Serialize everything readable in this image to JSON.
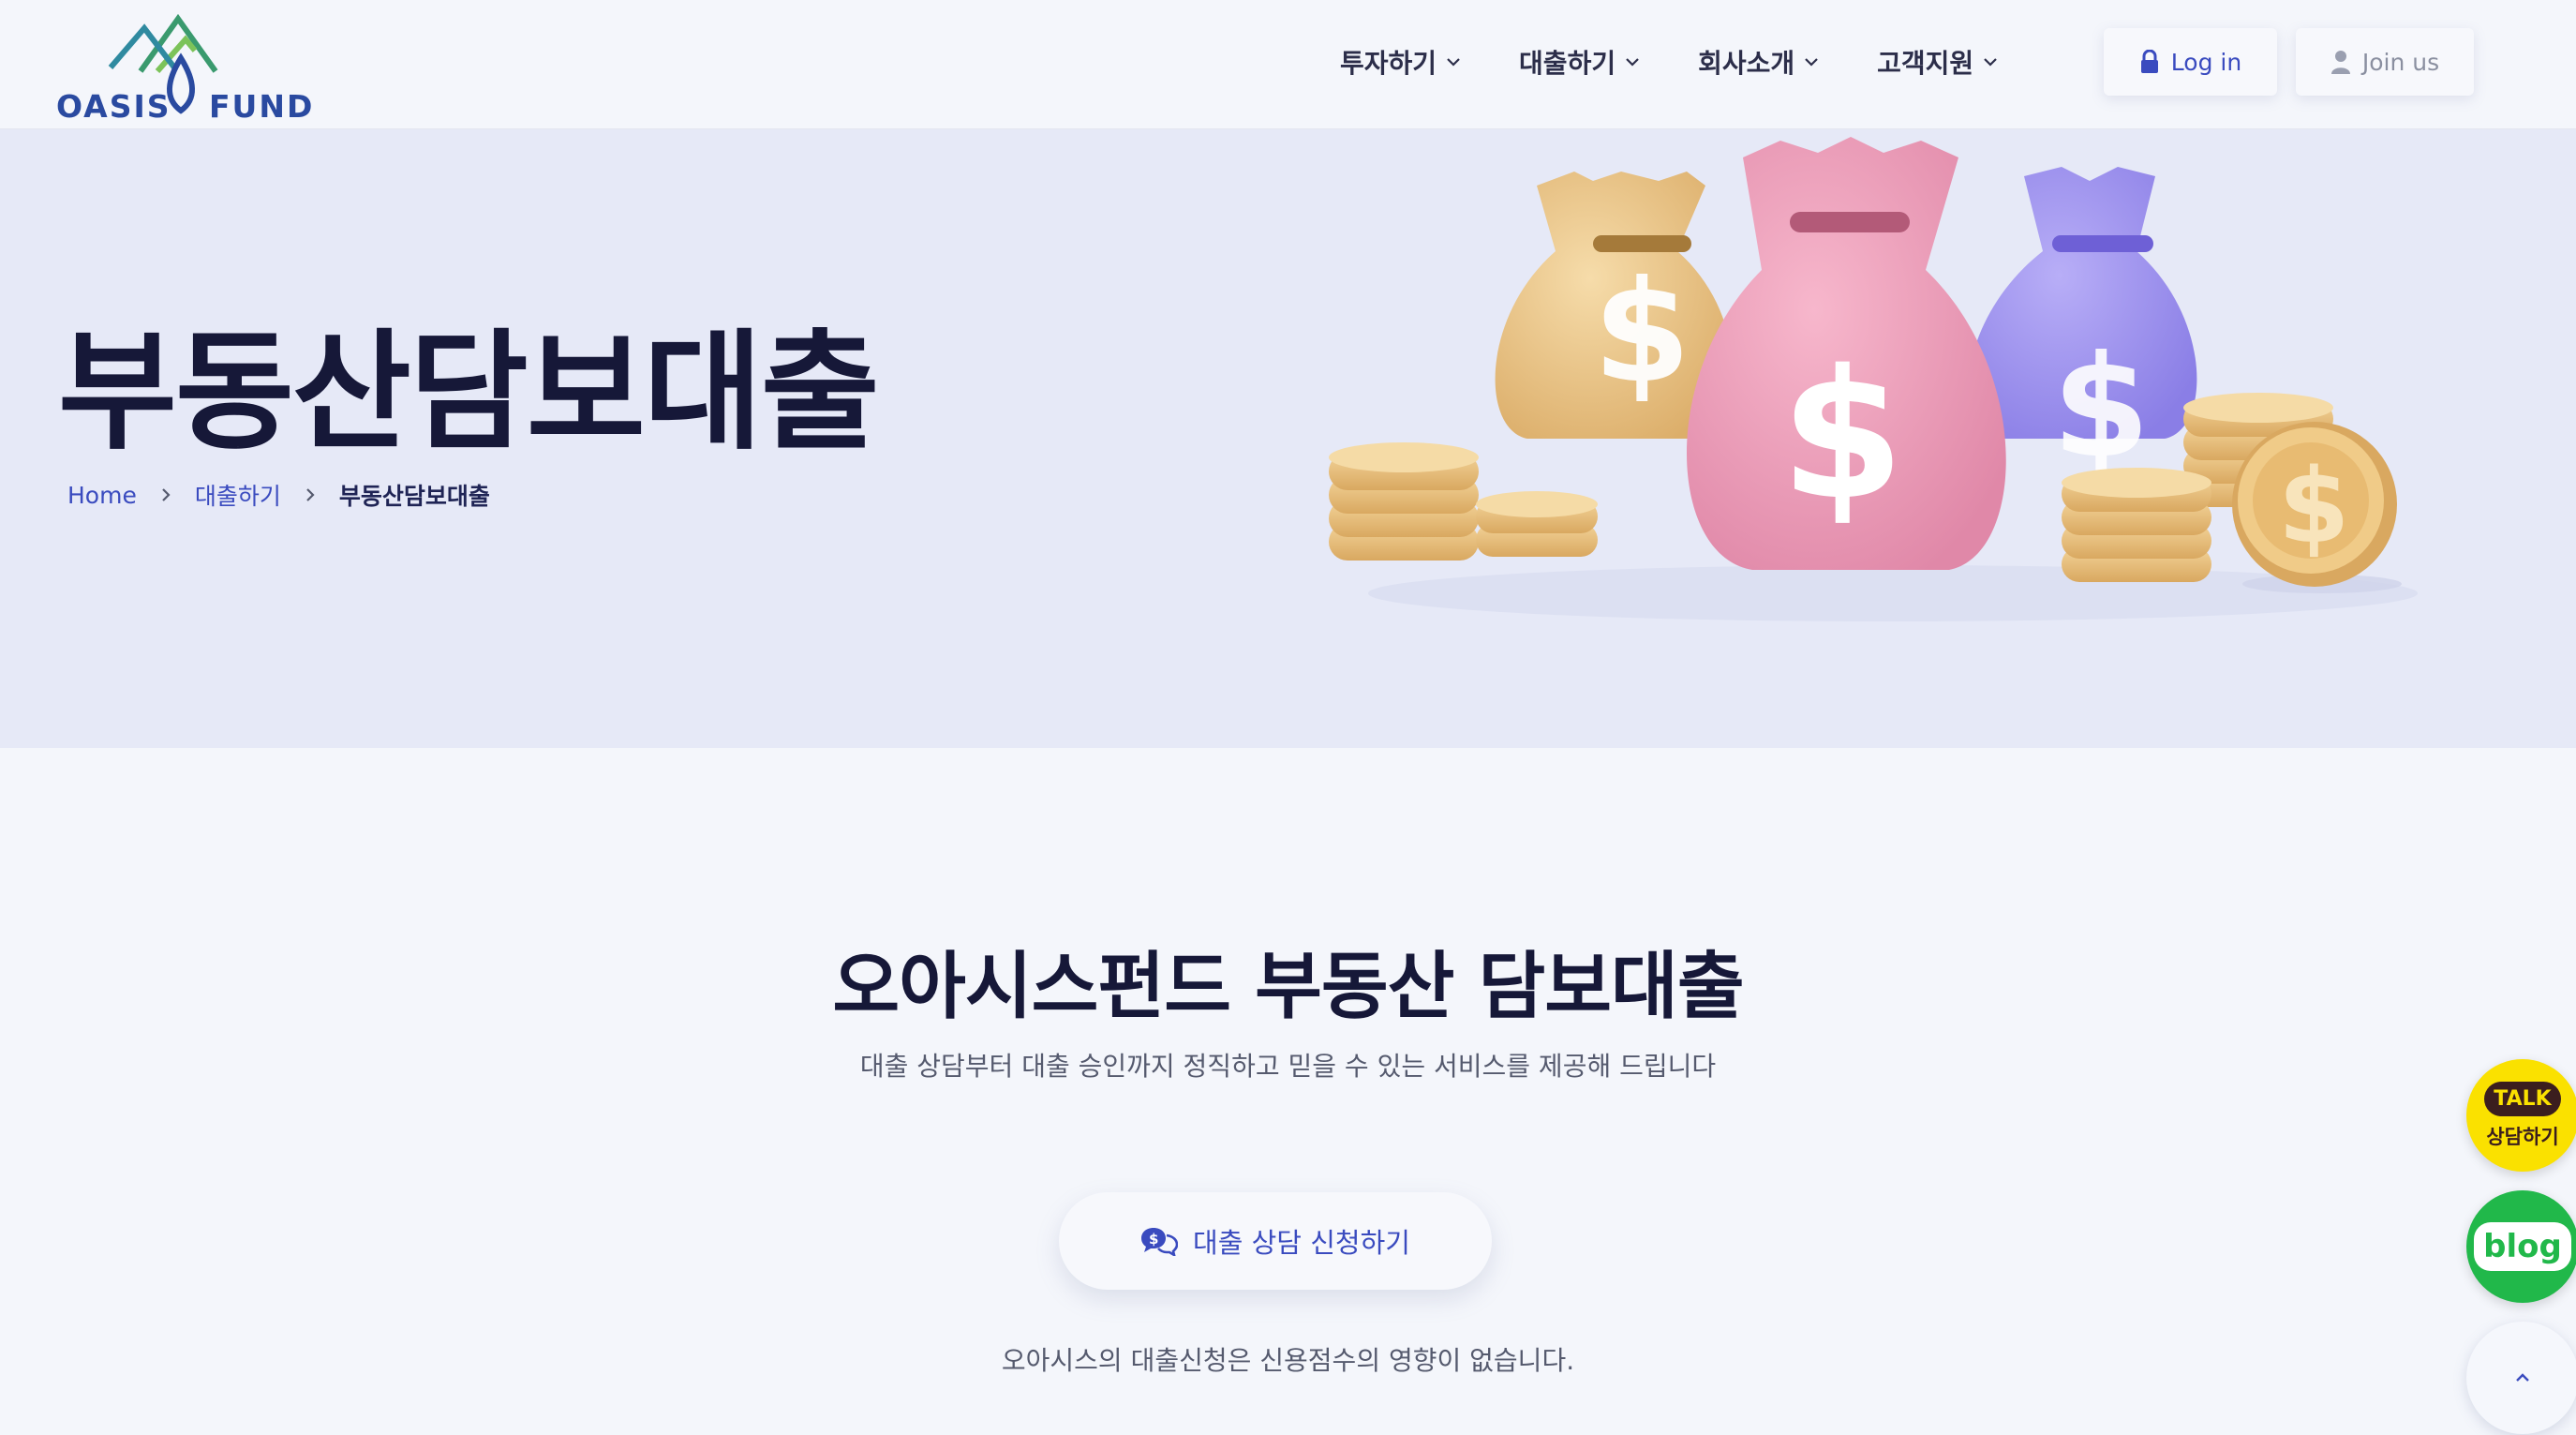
{
  "logo": {
    "left_text": "OASIS",
    "right_text": "FUND"
  },
  "nav": {
    "items": [
      {
        "label": "투자하기"
      },
      {
        "label": "대출하기"
      },
      {
        "label": "회사소개"
      },
      {
        "label": "고객지원"
      }
    ],
    "login_label": "Log in",
    "join_label": "Join us"
  },
  "hero": {
    "title": "부동산담보대출",
    "breadcrumb": {
      "home": "Home",
      "parent": "대출하기",
      "current": "부동산담보대출"
    }
  },
  "main": {
    "title": "오아시스펀드 부동산 담보대출",
    "subtitle": "대출 상담부터 대출 승인까지 정직하고 믿을 수 있는 서비스를 제공해 드립니다",
    "cta_label": "대출 상담 신청하기",
    "note": "오아시스의 대출신청은 신용점수의 영향이 없습니다."
  },
  "floating": {
    "talk_bubble": "TALK",
    "talk_label": "상담하기",
    "blog_label": "blog"
  },
  "colors": {
    "accent": "#3a4bbf",
    "hero_bg": "#e6e9f7",
    "page_bg": "#f4f6fb",
    "kakao_yellow": "#fae100",
    "naver_green": "#21b84a"
  },
  "icons": {
    "nav_dropdown": "chevron-down-icon",
    "login": "lock-icon",
    "join": "user-icon",
    "breadcrumb_sep": "chevron-right-icon",
    "cta": "chat-dollar-icon",
    "top": "chevron-up-icon"
  }
}
